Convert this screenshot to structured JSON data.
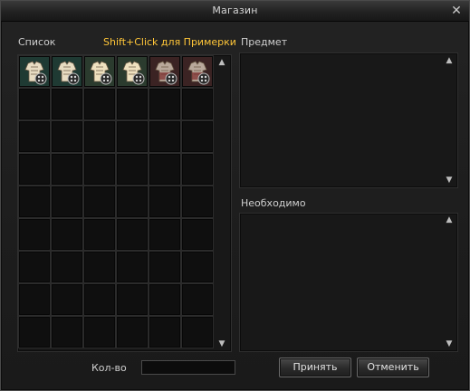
{
  "window": {
    "title": "Магазин"
  },
  "left": {
    "list_label": "Список",
    "hint": "Shift+Click для Примерки",
    "items": [
      {
        "name": "item-armor-set-1",
        "color": "#e8dcc2",
        "variant": "dark"
      },
      {
        "name": "item-armor-set-2",
        "color": "#e8dcc2",
        "variant": "dark"
      },
      {
        "name": "item-armor-set-3",
        "color": "#efe1bf",
        "variant": "light"
      },
      {
        "name": "item-armor-set-4",
        "color": "#efe1bf",
        "variant": "light"
      },
      {
        "name": "item-armor-set-5",
        "color": "#b9a89b",
        "variant": "red"
      },
      {
        "name": "item-armor-set-6",
        "color": "#b9a89b",
        "variant": "red"
      }
    ]
  },
  "right": {
    "item_label": "Предмет",
    "required_label": "Необходимо"
  },
  "footer": {
    "qty_label": "Кол-во",
    "qty_value": "",
    "accept_label": "Принять",
    "cancel_label": "Отменить"
  },
  "icons": {
    "close": "close-icon",
    "up": "scroll-up-icon",
    "down": "scroll-down-icon"
  }
}
